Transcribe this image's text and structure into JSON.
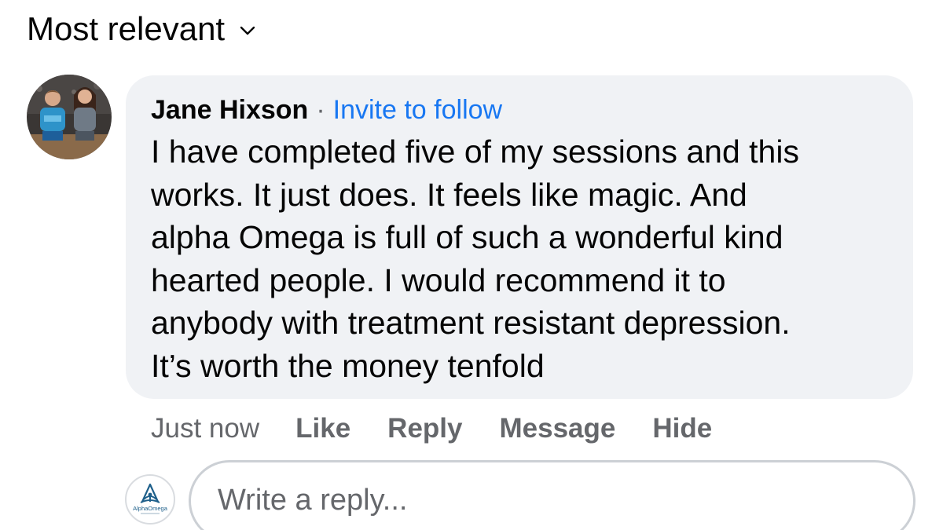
{
  "sort": {
    "label": "Most relevant",
    "icon": "chevron-down-icon"
  },
  "comment": {
    "author": "Jane Hixson",
    "separator": "·",
    "invite_label": "Invite to follow",
    "text": "I have completed five of my sessions and this\nworks. It just does. It feels like magic. And\nalpha Omega is full of such a wonderful kind\nhearted people. I would recommend it to\nanybody with treatment resistant depression.\nIt’s worth the money tenfold",
    "timestamp": "Just now",
    "actions": {
      "like": "Like",
      "reply": "Reply",
      "message": "Message",
      "hide": "Hide"
    }
  },
  "reply": {
    "placeholder": "Write a reply...",
    "page_logo_text": "AlphaOmega"
  },
  "colors": {
    "bubble": "#f0f2f5",
    "link": "#1877f2",
    "secondary": "#65676b",
    "text": "#050505",
    "logo": "#1d5f8a"
  }
}
